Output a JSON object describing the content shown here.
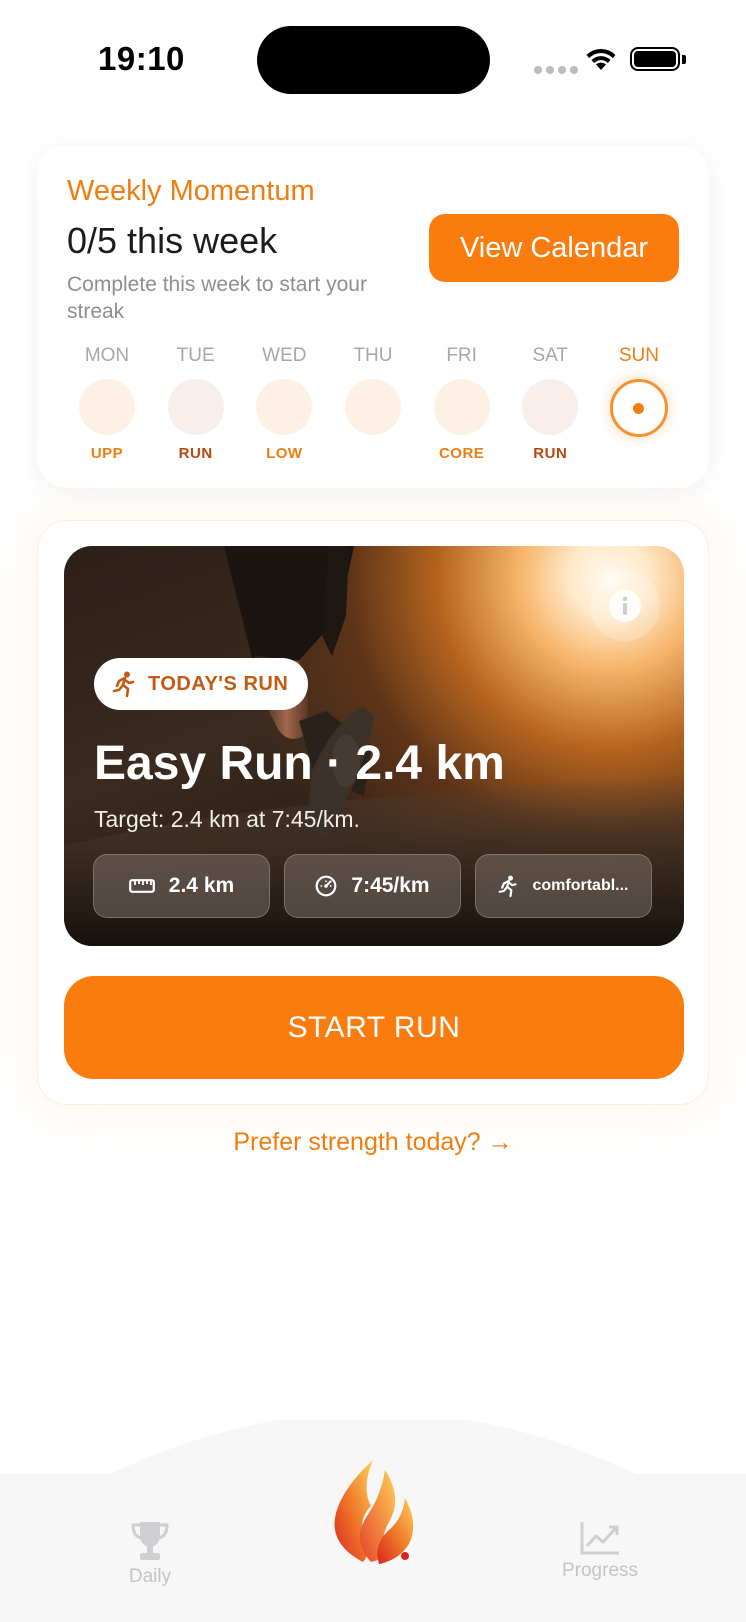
{
  "status_bar": {
    "time": "19:10"
  },
  "weekly": {
    "title": "Weekly Momentum",
    "count": "0/5 this week",
    "subtitle": "Complete this week to start your streak",
    "view_calendar_label": "View Calendar",
    "days": [
      {
        "name": "MON",
        "tag": "UPP"
      },
      {
        "name": "TUE",
        "tag": "RUN"
      },
      {
        "name": "WED",
        "tag": "LOW"
      },
      {
        "name": "THU",
        "tag": ""
      },
      {
        "name": "FRI",
        "tag": "CORE"
      },
      {
        "name": "SAT",
        "tag": "RUN"
      },
      {
        "name": "SUN",
        "tag": ""
      }
    ],
    "today": "SUN"
  },
  "run": {
    "badge_label": "TODAY'S RUN",
    "title": "Easy Run · 2.4 km",
    "target": "Target: 2.4 km at 7:45/km.",
    "chips": [
      {
        "icon": "ruler-icon",
        "label": "2.4 km"
      },
      {
        "icon": "speedometer-icon",
        "label": "7:45/km"
      },
      {
        "icon": "runner-icon",
        "label": "comfortabl..."
      }
    ],
    "start_label": "START RUN"
  },
  "prefer_link": "Prefer strength today? →",
  "tabs": {
    "daily": "Daily",
    "progress": "Progress"
  },
  "colors": {
    "accent": "#fb7c0e",
    "accent_text": "#f07d10",
    "tag_brown": "#b8480d"
  }
}
